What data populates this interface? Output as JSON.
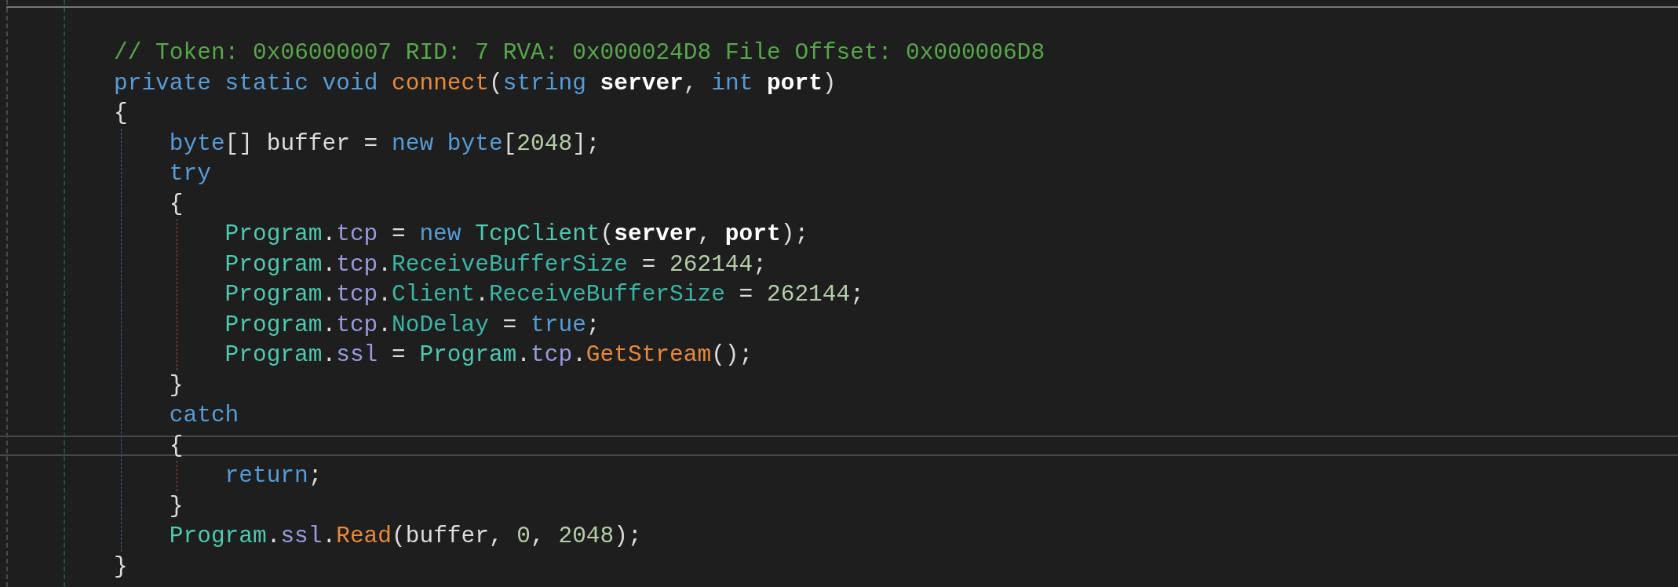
{
  "method": {
    "lines": [
      {
        "current": false,
        "tokens": [
          {
            "kind": "comment",
            "text": "// Token: 0x06000007 RID: 7 RVA: 0x000024D8 File Offset: 0x000006D8"
          }
        ]
      },
      {
        "current": false,
        "tokens": [
          {
            "kind": "keyword",
            "text": "private"
          },
          {
            "kind": "keyword",
            "text": " static"
          },
          {
            "kind": "keyword",
            "text": " void"
          },
          {
            "kind": "method",
            "text": " connect"
          },
          {
            "kind": "plain",
            "text": "("
          },
          {
            "kind": "keyword",
            "text": "string"
          },
          {
            "kind": "param",
            "text": " server"
          },
          {
            "kind": "plain",
            "text": ","
          },
          {
            "kind": "keyword",
            "text": " int"
          },
          {
            "kind": "param",
            "text": " port"
          },
          {
            "kind": "plain",
            "text": ")"
          }
        ]
      },
      {
        "current": false,
        "tokens": [
          {
            "kind": "plain",
            "text": "{"
          }
        ],
        "children": [
          {
            "current": false,
            "tokens": [
              {
                "kind": "keyword",
                "text": "byte"
              },
              {
                "kind": "plain",
                "text": "[] buffer ="
              },
              {
                "kind": "keyword",
                "text": " new"
              },
              {
                "kind": "keyword",
                "text": " byte"
              },
              {
                "kind": "plain",
                "text": "["
              },
              {
                "kind": "number",
                "text": "2048"
              },
              {
                "kind": "plain",
                "text": "];"
              }
            ]
          },
          {
            "current": false,
            "tokens": [
              {
                "kind": "keyword",
                "text": "try"
              }
            ]
          },
          {
            "current": false,
            "tokens": [
              {
                "kind": "plain",
                "text": "{"
              }
            ],
            "children": [
              {
                "current": false,
                "tokens": [
                  {
                    "kind": "class",
                    "text": "Program"
                  },
                  {
                    "kind": "plain",
                    "text": "."
                  },
                  {
                    "kind": "field",
                    "text": "tcp"
                  },
                  {
                    "kind": "plain",
                    "text": " ="
                  },
                  {
                    "kind": "keyword",
                    "text": " new"
                  },
                  {
                    "kind": "class",
                    "text": " TcpClient"
                  },
                  {
                    "kind": "plain",
                    "text": "("
                  },
                  {
                    "kind": "param",
                    "text": "server"
                  },
                  {
                    "kind": "plain",
                    "text": ","
                  },
                  {
                    "kind": "param",
                    "text": " port"
                  },
                  {
                    "kind": "plain",
                    "text": ");"
                  }
                ]
              },
              {
                "current": false,
                "tokens": [
                  {
                    "kind": "class",
                    "text": "Program"
                  },
                  {
                    "kind": "plain",
                    "text": "."
                  },
                  {
                    "kind": "field",
                    "text": "tcp"
                  },
                  {
                    "kind": "plain",
                    "text": "."
                  },
                  {
                    "kind": "property",
                    "text": "ReceiveBufferSize"
                  },
                  {
                    "kind": "plain",
                    "text": " ="
                  },
                  {
                    "kind": "number",
                    "text": " 262144"
                  },
                  {
                    "kind": "plain",
                    "text": ";"
                  }
                ]
              },
              {
                "current": false,
                "tokens": [
                  {
                    "kind": "class",
                    "text": "Program"
                  },
                  {
                    "kind": "plain",
                    "text": "."
                  },
                  {
                    "kind": "field",
                    "text": "tcp"
                  },
                  {
                    "kind": "plain",
                    "text": "."
                  },
                  {
                    "kind": "property",
                    "text": "Client"
                  },
                  {
                    "kind": "plain",
                    "text": "."
                  },
                  {
                    "kind": "property",
                    "text": "ReceiveBufferSize"
                  },
                  {
                    "kind": "plain",
                    "text": " ="
                  },
                  {
                    "kind": "number",
                    "text": " 262144"
                  },
                  {
                    "kind": "plain",
                    "text": ";"
                  }
                ]
              },
              {
                "current": false,
                "tokens": [
                  {
                    "kind": "class",
                    "text": "Program"
                  },
                  {
                    "kind": "plain",
                    "text": "."
                  },
                  {
                    "kind": "field",
                    "text": "tcp"
                  },
                  {
                    "kind": "plain",
                    "text": "."
                  },
                  {
                    "kind": "property",
                    "text": "NoDelay"
                  },
                  {
                    "kind": "plain",
                    "text": " ="
                  },
                  {
                    "kind": "keyword",
                    "text": " true"
                  },
                  {
                    "kind": "plain",
                    "text": ";"
                  }
                ]
              },
              {
                "current": false,
                "tokens": [
                  {
                    "kind": "class",
                    "text": "Program"
                  },
                  {
                    "kind": "plain",
                    "text": "."
                  },
                  {
                    "kind": "field",
                    "text": "ssl"
                  },
                  {
                    "kind": "plain",
                    "text": " ="
                  },
                  {
                    "kind": "class",
                    "text": " Program"
                  },
                  {
                    "kind": "plain",
                    "text": "."
                  },
                  {
                    "kind": "field",
                    "text": "tcp"
                  },
                  {
                    "kind": "plain",
                    "text": "."
                  },
                  {
                    "kind": "method",
                    "text": "GetStream"
                  },
                  {
                    "kind": "plain",
                    "text": "();"
                  }
                ]
              }
            ]
          },
          {
            "current": false,
            "tokens": [
              {
                "kind": "plain",
                "text": "}"
              }
            ]
          },
          {
            "current": false,
            "tokens": [
              {
                "kind": "keyword",
                "text": "catch"
              }
            ]
          },
          {
            "current": true,
            "tokens": [
              {
                "kind": "plain",
                "text": "{"
              }
            ],
            "children": [
              {
                "current": false,
                "tokens": [
                  {
                    "kind": "keyword",
                    "text": "return"
                  },
                  {
                    "kind": "plain",
                    "text": ";"
                  }
                ]
              }
            ]
          },
          {
            "current": false,
            "tokens": [
              {
                "kind": "plain",
                "text": "}"
              }
            ]
          },
          {
            "current": false,
            "tokens": [
              {
                "kind": "class",
                "text": "Program"
              },
              {
                "kind": "plain",
                "text": "."
              },
              {
                "kind": "field",
                "text": "ssl"
              },
              {
                "kind": "plain",
                "text": "."
              },
              {
                "kind": "method",
                "text": "Read"
              },
              {
                "kind": "plain",
                "text": "(buffer,"
              },
              {
                "kind": "number",
                "text": " 0"
              },
              {
                "kind": "plain",
                "text": ","
              },
              {
                "kind": "number",
                "text": " 2048"
              },
              {
                "kind": "plain",
                "text": ");"
              }
            ]
          }
        ]
      },
      {
        "current": false,
        "tokens": [
          {
            "kind": "plain",
            "text": "}"
          }
        ]
      }
    ]
  }
}
